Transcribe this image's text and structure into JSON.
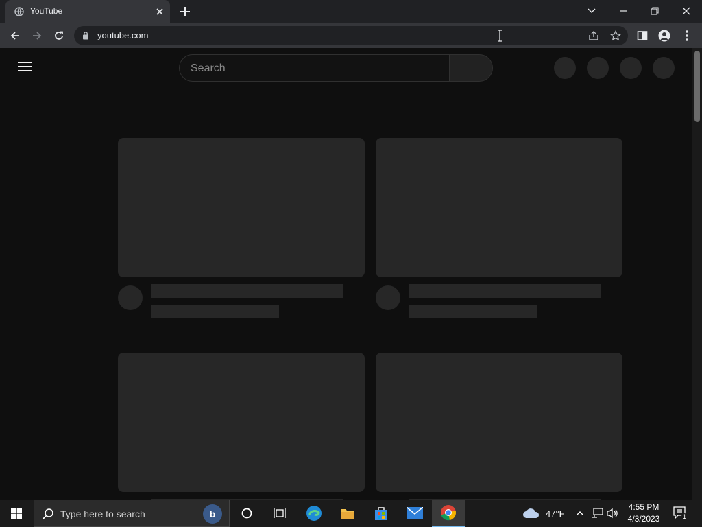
{
  "browser": {
    "tab_title": "YouTube",
    "url": "youtube.com"
  },
  "page": {
    "search_placeholder": "Search"
  },
  "taskbar": {
    "search_placeholder": "Type here to search",
    "weather": "47°F",
    "time": "4:55 PM",
    "date": "4/3/2023",
    "notification_count": "1"
  },
  "colors": {
    "page_bg": "#0f0f0f",
    "skeleton": "#272727",
    "chrome_bg": "#202124",
    "chrome_toolbar": "#35363a"
  }
}
